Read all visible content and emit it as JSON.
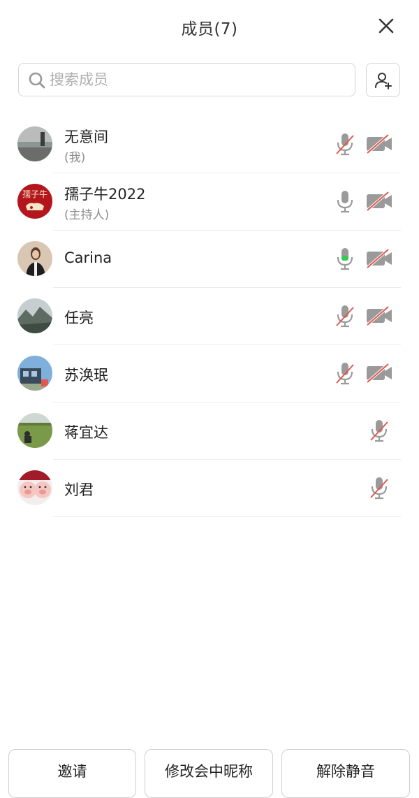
{
  "header": {
    "title": "成员(7)",
    "close_icon": "close-icon"
  },
  "search": {
    "placeholder": "搜索成员",
    "value": "",
    "icon": "search-icon",
    "add_member_icon": "add-person-icon"
  },
  "members": [
    {
      "name": "无意间",
      "role": "(我)",
      "mic": "muted",
      "camera": "off"
    },
    {
      "name": "孺子牛2022",
      "role": "(主持人)",
      "avatar_text": "孺子牛",
      "mic": "on",
      "camera": "off"
    },
    {
      "name": "Carina",
      "role": "",
      "mic": "speaking",
      "camera": "off"
    },
    {
      "name": "任亮",
      "role": "",
      "mic": "muted",
      "camera": "off"
    },
    {
      "name": "苏涣珉",
      "role": "",
      "mic": "muted",
      "camera": "off"
    },
    {
      "name": "蒋宜达",
      "role": "",
      "mic": "muted",
      "camera": "none"
    },
    {
      "name": "刘君",
      "role": "",
      "mic": "muted",
      "camera": "none"
    }
  ],
  "footer": {
    "invite_label": "邀请",
    "rename_label": "修改会中昵称",
    "unmute_label": "解除静音"
  },
  "colors": {
    "muted_slash": "#e0584f",
    "icon_gray": "#9a9a9a",
    "speaking_green": "#33cc55",
    "divider": "#ececec"
  }
}
